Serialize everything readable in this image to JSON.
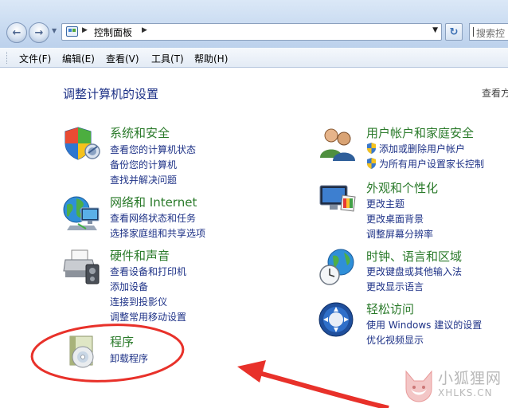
{
  "address": {
    "path_label": "控制面板"
  },
  "search": {
    "placeholder": "搜索控"
  },
  "menu": [
    "文件(F)",
    "编辑(E)",
    "查看(V)",
    "工具(T)",
    "帮助(H)"
  ],
  "content": {
    "title": "调整计算机的设置",
    "view_by": "查看方式"
  },
  "left_categories": [
    {
      "title": "系统和安全",
      "icon": "shield-icon",
      "links": [
        "查看您的计算机状态",
        "备份您的计算机",
        "查找并解决问题"
      ]
    },
    {
      "title": "网络和 Internet",
      "icon": "network-globe-icon",
      "links": [
        "查看网络状态和任务",
        "选择家庭组和共享选项"
      ]
    },
    {
      "title": "硬件和声音",
      "icon": "printer-speaker-icon",
      "links": [
        "查看设备和打印机",
        "添加设备",
        "连接到投影仪",
        "调整常用移动设置"
      ]
    },
    {
      "title": "程序",
      "icon": "programs-disc-icon",
      "links": [
        "卸载程序"
      ]
    }
  ],
  "right_categories": [
    {
      "title": "用户帐户和家庭安全",
      "icon": "users-icon",
      "links": [
        "添加或删除用户帐户",
        "为所有用户设置家长控制"
      ]
    },
    {
      "title": "外观和个性化",
      "icon": "monitor-palette-icon",
      "links": [
        "更改主题",
        "更改桌面背景",
        "调整屏幕分辨率"
      ]
    },
    {
      "title": "时钟、语言和区域",
      "icon": "globe-clock-icon",
      "links": [
        "更改键盘或其他输入法",
        "更改显示语言"
      ]
    },
    {
      "title": "轻松访问",
      "icon": "ease-of-access-icon",
      "links": [
        "使用 Windows 建议的设置",
        "优化视频显示"
      ]
    }
  ],
  "watermark": {
    "line1": "小狐狸网",
    "line2": "XHLKS.CN"
  },
  "colors": {
    "category_title": "#2a7a2a",
    "link": "#1e3287",
    "annotation": "#e8312a"
  }
}
